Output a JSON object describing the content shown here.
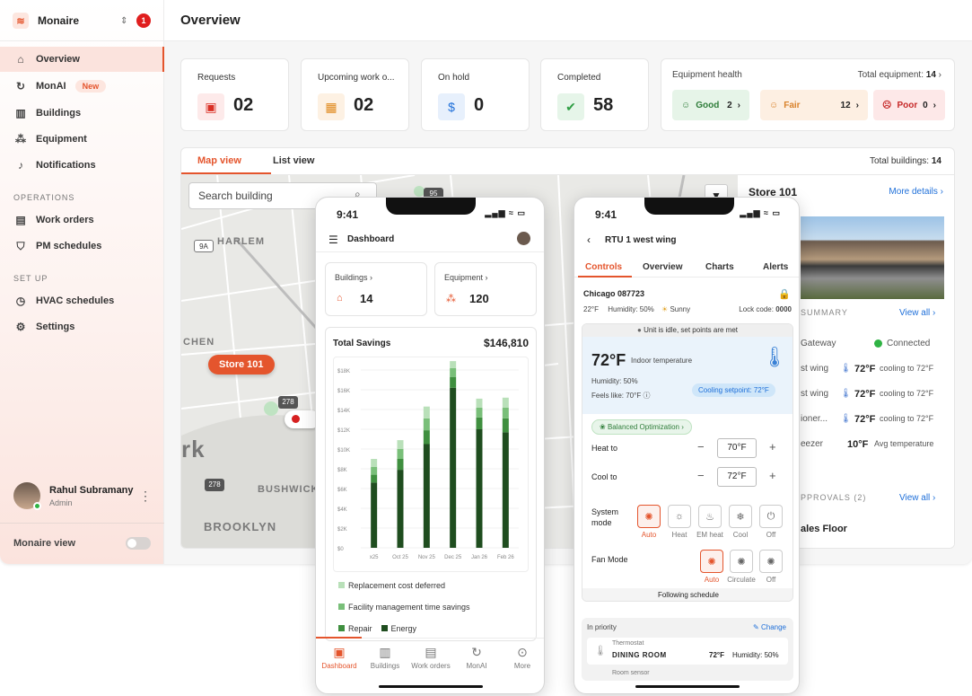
{
  "sidebar": {
    "org_name": "Monaire",
    "notif_count": "1",
    "nav": [
      {
        "label": "Overview",
        "icon": "home-icon"
      },
      {
        "label": "MonAI",
        "icon": "ai-icon"
      },
      {
        "label": "Buildings",
        "icon": "building-icon"
      },
      {
        "label": "Equipment",
        "icon": "equipment-icon"
      },
      {
        "label": "Notifications",
        "icon": "bell-icon"
      }
    ],
    "new_badge": "New",
    "sections": {
      "operations": "OPERATIONS",
      "setup": "SET UP"
    },
    "ops_nav": [
      {
        "label": "Work orders",
        "icon": "clipboard-icon"
      },
      {
        "label": "PM schedules",
        "icon": "shield-check-icon"
      }
    ],
    "setup_nav": [
      {
        "label": "HVAC schedules",
        "icon": "clock-icon"
      },
      {
        "label": "Settings",
        "icon": "gear-icon"
      }
    ],
    "user": {
      "name": "Rahul Subramany",
      "role": "Admin"
    },
    "view_label": "Monaire view"
  },
  "page": {
    "title": "Overview"
  },
  "stats": [
    {
      "label": "Requests",
      "value": "02",
      "icon": "request-icon",
      "color": "#d93025",
      "bg": "#fdeaea"
    },
    {
      "label": "Upcoming work o...",
      "value": "02",
      "icon": "calendar-icon",
      "color": "#e08a1e",
      "bg": "#fdf1e3"
    },
    {
      "label": "On hold",
      "value": "0",
      "icon": "dollar-icon",
      "color": "#1e6fd9",
      "bg": "#e7f0fc"
    },
    {
      "label": "Completed",
      "value": "58",
      "icon": "check-icon",
      "color": "#2f9e44",
      "bg": "#e6f5e9"
    }
  ],
  "equipment_health": {
    "title": "Equipment health",
    "total_label": "Total equipment:",
    "total": "14",
    "chips": [
      {
        "label": "Good",
        "count": "2",
        "color": "#2f7d3a",
        "bg": "#e6f4e8"
      },
      {
        "label": "Fair",
        "count": "12",
        "color": "#d9822b",
        "bg": "#fdefe2"
      },
      {
        "label": "Poor",
        "count": "0",
        "color": "#c62828",
        "bg": "#fde8e8"
      }
    ]
  },
  "map": {
    "tabs": [
      "Map view",
      "List view"
    ],
    "total_label": "Total buildings:",
    "total": "14",
    "search_placeholder": "Search building",
    "pin": "Store 101",
    "labels": [
      "HARLEM",
      "CHEN",
      "BUSHWICK",
      "BROOKLYN",
      "rk"
    ],
    "shields": [
      "95",
      "9A",
      "278",
      "278"
    ]
  },
  "side_panel": {
    "title": "Store 101",
    "more": "More details",
    "summary": "SUMMARY",
    "view_all": "View all",
    "gateway": "Gateway",
    "connected": "Connected",
    "rows": [
      {
        "name": "st wing",
        "temp": "72°F",
        "desc": "cooling to 72°F"
      },
      {
        "name": "st wing",
        "temp": "72°F",
        "desc": "cooling to 72°F"
      },
      {
        "name": "ioner...",
        "temp": "72°F",
        "desc": "cooling to 72°F"
      },
      {
        "name": "eezer",
        "temp": "10°F",
        "desc": "Avg temperature"
      }
    ],
    "approvals": "PPROVALS (2)",
    "view_all2": "View all",
    "sales": "ales Floor"
  },
  "phone1": {
    "time": "9:41",
    "header": "Dashboard",
    "buildings_label": "Buildings",
    "buildings": "14",
    "equipment_label": "Equipment",
    "equipment": "120",
    "savings_label": "Total Savings",
    "savings": "$146,810",
    "legend": [
      "Replacement cost deferred",
      "Facility management time savings",
      "Repair",
      "Energy"
    ],
    "nav": [
      "Dashboard",
      "Buildings",
      "Work orders",
      "MonAI",
      "More"
    ]
  },
  "phone2": {
    "time": "9:41",
    "header": "RTU 1 west wing",
    "tabs": [
      "Controls",
      "Overview",
      "Charts",
      "Alerts"
    ],
    "location": "Chicago 087723",
    "weather": "22°F",
    "humidity": "Humidity: 50%",
    "sky": "Sunny",
    "lock": "Lock code:",
    "lock_code": "0000",
    "idle": "Unit is idle, set points are met",
    "indoor_temp": "72°F",
    "indoor_label": "Indoor temperature",
    "indoor_humidity": "Humidity: 50%",
    "feels": "Feels like: 70°F",
    "setpoint": "Cooling setpoint: 72°F",
    "optimization": "Balanced Optimization",
    "heat_label": "Heat to",
    "heat": "70°F",
    "cool_label": "Cool to",
    "cool": "72°F",
    "system_mode": "System mode",
    "modes": [
      "Auto",
      "Heat",
      "EM heat",
      "Cool",
      "Off"
    ],
    "fan_mode": "Fan Mode",
    "fan_modes": [
      "Auto",
      "Circulate",
      "Off"
    ],
    "schedule": "Following schedule",
    "priority": "In priority",
    "change": "Change",
    "thermo_label": "Thermostat",
    "room": "DINING ROOM",
    "room_temp": "72°F",
    "room_hum": "Humidity: 50%",
    "room_sensor": "Room sensor"
  },
  "chart_data": {
    "type": "bar",
    "title": "Total Savings",
    "categories": [
      "x25",
      "Oct 25",
      "Nov 25",
      "Dec 25",
      "Jan 26",
      "Feb 26"
    ],
    "ylim": [
      0,
      18000
    ],
    "yticks": [
      "$0",
      "$2K",
      "$4K",
      "$6K",
      "$8K",
      "$10K",
      "$12K",
      "$14K",
      "$16K",
      "$18K"
    ],
    "series": [
      {
        "name": "Energy",
        "color": "#1f4d1f",
        "values": [
          6600,
          7900,
          10500,
          16200,
          12000,
          11700
        ]
      },
      {
        "name": "Repair",
        "color": "#3f8f3f",
        "values": [
          800,
          1100,
          1400,
          1100,
          1200,
          1400
        ]
      },
      {
        "name": "Facility management time savings",
        "color": "#79bf79",
        "values": [
          800,
          1000,
          1200,
          900,
          1000,
          1100
        ]
      },
      {
        "name": "Replacement cost deferred",
        "color": "#b9e0b9",
        "values": [
          800,
          900,
          1200,
          700,
          900,
          1000
        ]
      }
    ]
  }
}
